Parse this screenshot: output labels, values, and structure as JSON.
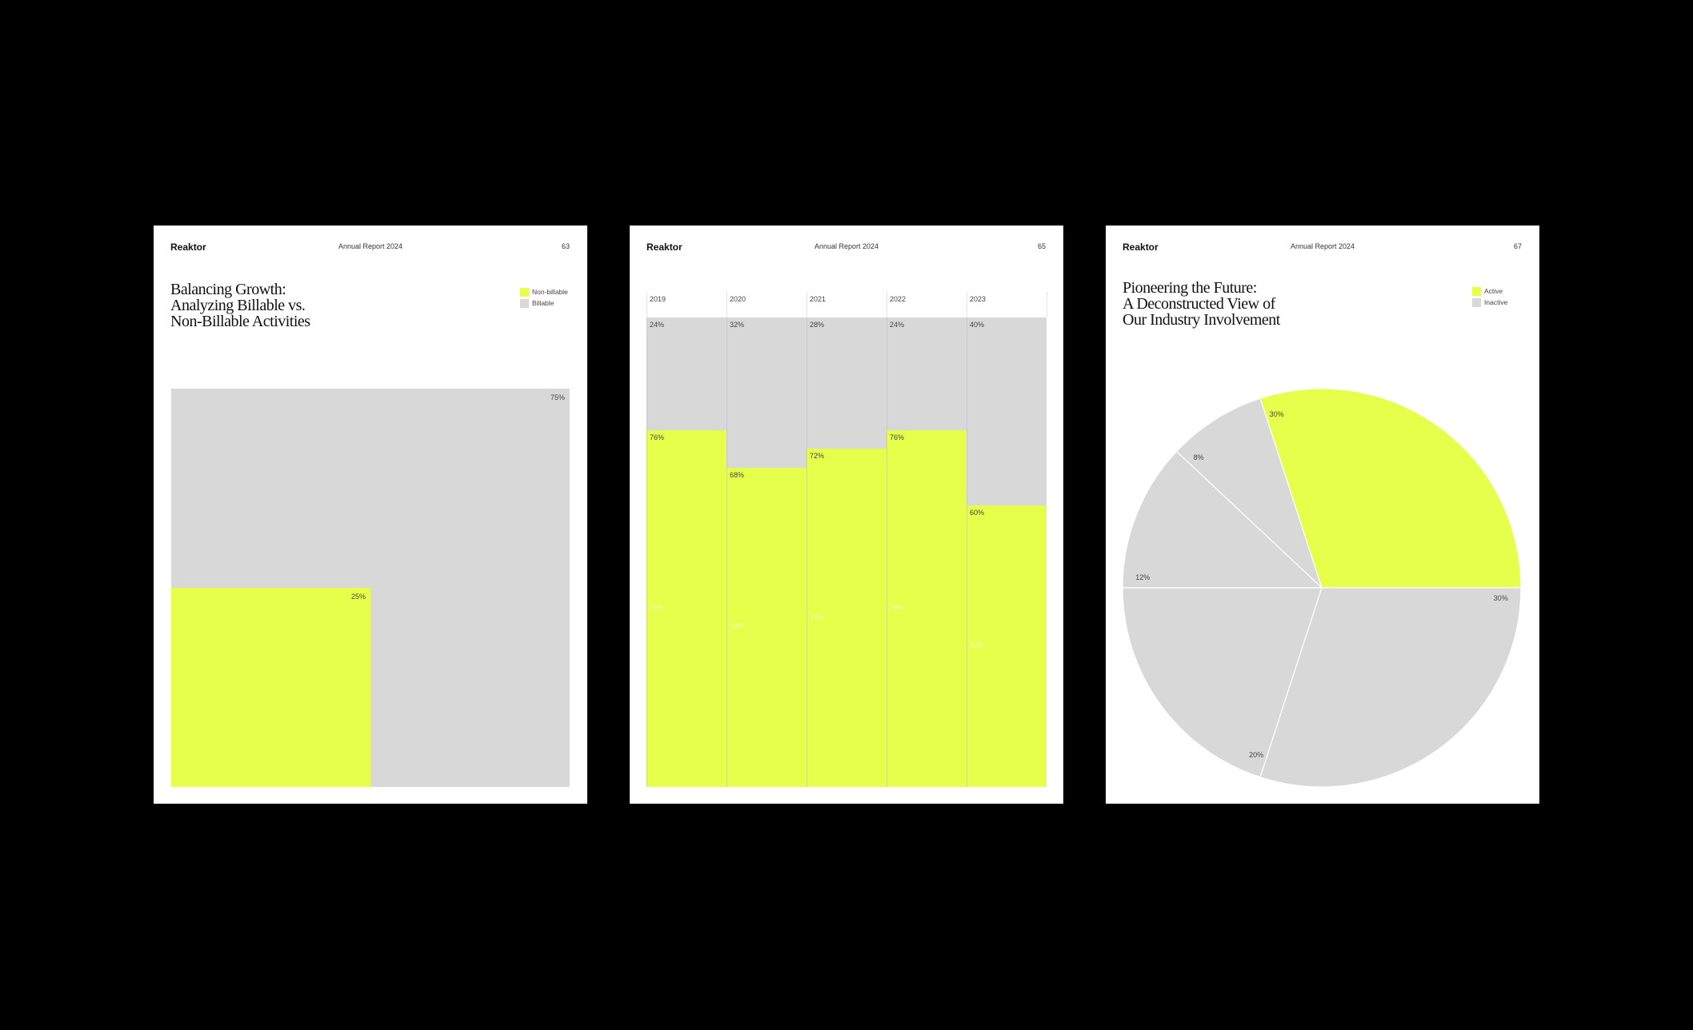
{
  "colors": {
    "accent": "#e6ff4a",
    "gray": "#d8d8d8",
    "background": "#000000"
  },
  "pages": [
    {
      "brand": "Reaktor",
      "report": "Annual Report 2024",
      "page_number": "63",
      "title_lines": [
        "Balancing Growth:",
        "Analyzing Billable vs.",
        "Non-Billable Activities"
      ],
      "legend": [
        {
          "label": "Non-billable",
          "color": "#e6ff4a"
        },
        {
          "label": "Billable",
          "color": "#d8d8d8"
        }
      ]
    },
    {
      "brand": "Reaktor",
      "report": "Annual Report 2024",
      "page_number": "65"
    },
    {
      "brand": "Reaktor",
      "report": "Annual Report 2024",
      "page_number": "67",
      "title_lines": [
        "Pioneering the Future:",
        "A Deconstructed View of",
        "Our Industry Involvement"
      ],
      "legend": [
        {
          "label": "Active",
          "color": "#e6ff4a"
        },
        {
          "label": "Inactive",
          "color": "#d8d8d8"
        }
      ]
    }
  ],
  "chart_data": [
    {
      "type": "area-square",
      "series": [
        {
          "name": "Non-billable",
          "value": 25,
          "label": "25%"
        },
        {
          "name": "Billable",
          "value": 75,
          "label": "75%"
        }
      ]
    },
    {
      "type": "bar",
      "stacked": true,
      "categories": [
        "2019",
        "2020",
        "2021",
        "2022",
        "2023"
      ],
      "series": [
        {
          "values": [
            76,
            68,
            72,
            76,
            60
          ],
          "labels": [
            "76%",
            "68%",
            "72%",
            "76%",
            "60%"
          ],
          "color": "#e6ff4a"
        },
        {
          "values": [
            24,
            32,
            28,
            24,
            40
          ],
          "labels": [
            "24%",
            "32%",
            "28%",
            "24%",
            "40%"
          ],
          "color": "#d8d8d8"
        }
      ],
      "ylim": [
        0,
        100
      ]
    },
    {
      "type": "pie",
      "slices": [
        {
          "value": 30,
          "label": "30%",
          "group": "Active"
        },
        {
          "value": 8,
          "label": "8%",
          "group": "Inactive"
        },
        {
          "value": 12,
          "label": "12%",
          "group": "Inactive"
        },
        {
          "value": 20,
          "label": "20%",
          "group": "Inactive"
        },
        {
          "value": 30,
          "label": "30%",
          "group": "Inactive"
        }
      ]
    }
  ]
}
